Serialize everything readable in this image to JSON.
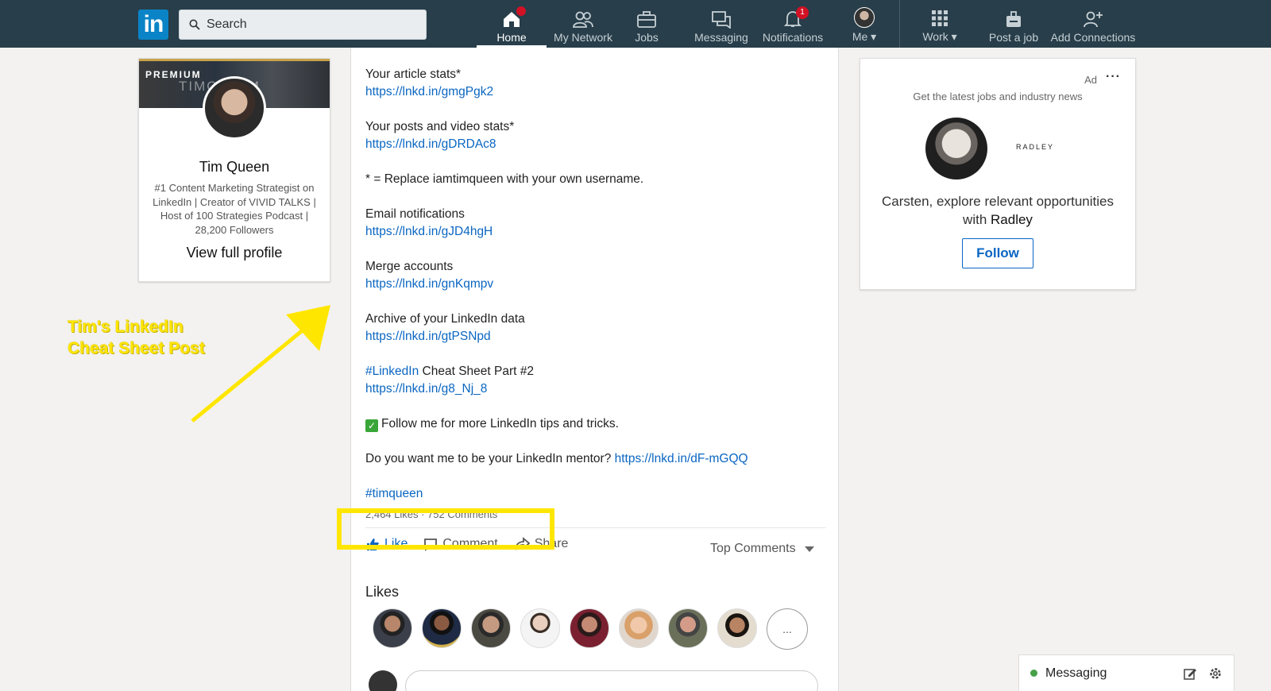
{
  "nav": {
    "search_placeholder": "Search",
    "items": [
      {
        "label": "Home",
        "badge": ""
      },
      {
        "label": "My Network"
      },
      {
        "label": "Jobs"
      },
      {
        "label": "Messaging"
      },
      {
        "label": "Notifications",
        "badge": "1"
      },
      {
        "label": "Me"
      },
      {
        "label": "Work"
      },
      {
        "label": "Post a job"
      },
      {
        "label": "Add Connections"
      }
    ]
  },
  "profile": {
    "premium": "PREMIUM",
    "cover_text": "TIMQ      COM",
    "name": "Tim Queen",
    "description": "#1 Content Marketing Strategist on LinkedIn | Creator of VIVID TALKS | Host of 100 Strategies Podcast | 28,200 Followers",
    "view_link": "View full profile"
  },
  "annotation": {
    "line1": "Tim's LinkedIn",
    "line2": "Cheat Sheet Post"
  },
  "post": {
    "blocks": [
      {
        "text": "Your article stats*",
        "link": "https://lnkd.in/gmgPgk2"
      },
      {
        "text": "Your posts and video stats*",
        "link": "https://lnkd.in/gDRDAc8"
      },
      {
        "text": "* = Replace iamtimqueen with your own username.",
        "link": ""
      },
      {
        "text": "Email notifications",
        "link": "https://lnkd.in/gJD4hgH"
      },
      {
        "text": "Merge accounts",
        "link": "https://lnkd.in/gnKqmpv"
      },
      {
        "text": "Archive of your LinkedIn data",
        "link": "https://lnkd.in/gtPSNpd"
      }
    ],
    "cheat_tag": "#LinkedIn",
    "cheat_text": " Cheat Sheet Part #2",
    "cheat_link": "https://lnkd.in/g8_Nj_8",
    "follow_text": "Follow me for more LinkedIn tips and tricks.",
    "mentor_text": "Do you want me to be your LinkedIn mentor? ",
    "mentor_link": "https://lnkd.in/dF-mGQQ",
    "hashtag": "#timqueen",
    "stats": "2,464 Likes · 752 Comments",
    "actions": {
      "like": "Like",
      "comment": "Comment",
      "share": "Share"
    },
    "top_comments": "Top Comments",
    "likes_heading": "Likes",
    "more_likes": "..."
  },
  "ad": {
    "label": "Ad",
    "dots": "···",
    "headline": "Get the latest jobs and industry news",
    "logo": "RADLEY",
    "text_prefix": "Carsten, explore relevant opportunities with ",
    "company": "Radley",
    "follow": "Follow"
  },
  "messaging": {
    "label": "Messaging"
  },
  "colors": {
    "nav_bg": "#283e4a",
    "link": "#0a66c2",
    "highlight": "#ffe600",
    "badge": "#d11124"
  }
}
